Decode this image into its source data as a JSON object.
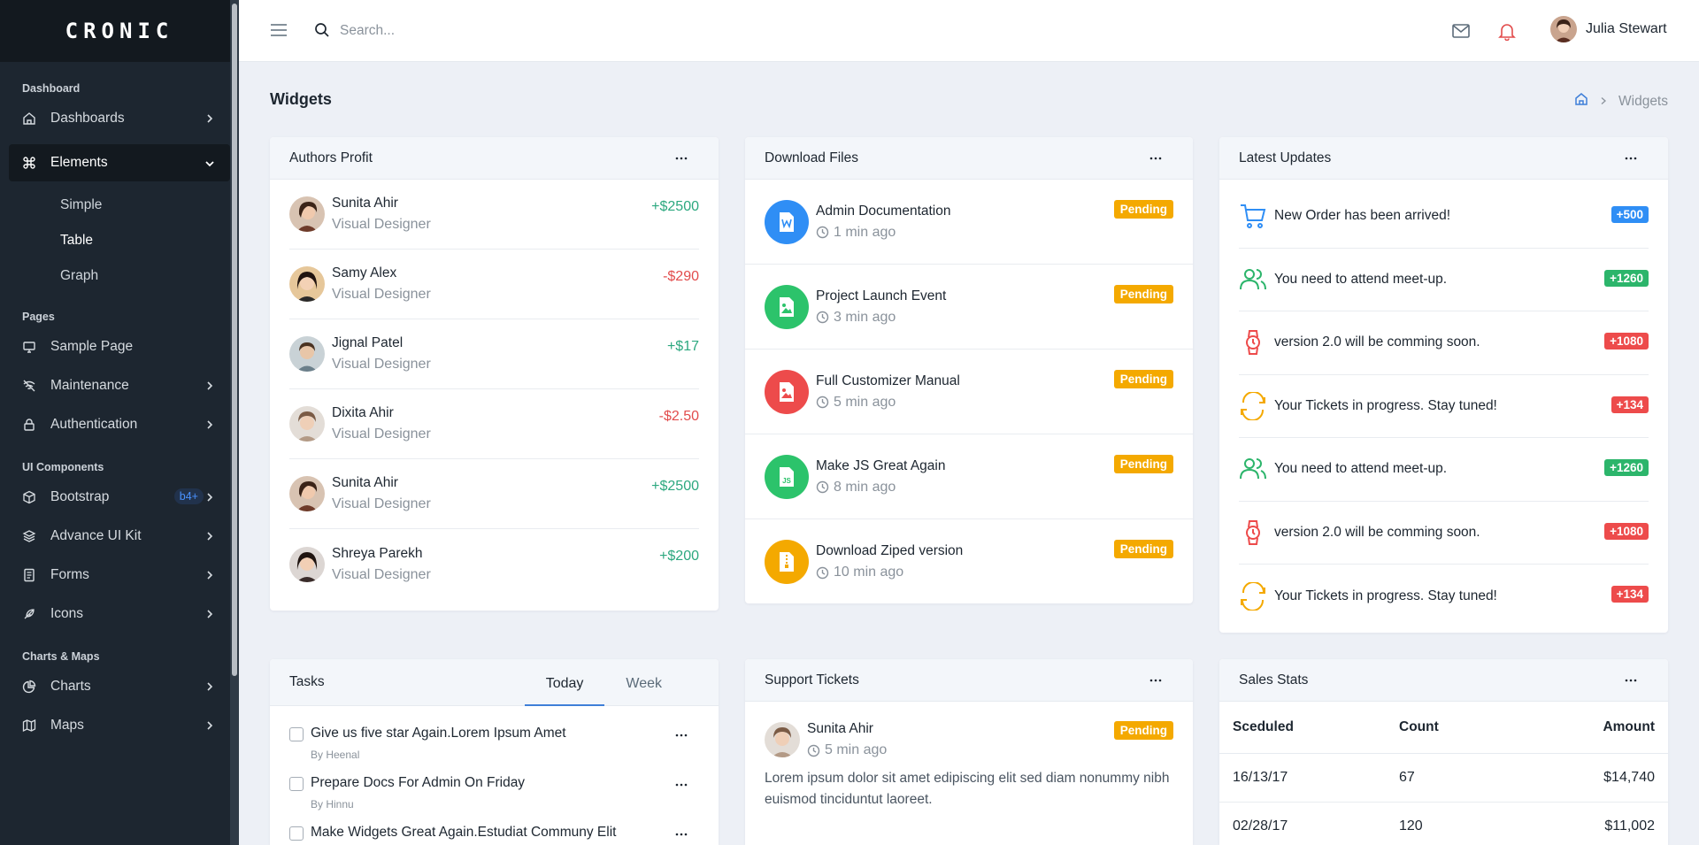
{
  "brand": {
    "logo": "CRONIC"
  },
  "sidebar": {
    "groups": [
      {
        "caption": "Dashboard"
      },
      {
        "caption": "Pages"
      },
      {
        "caption": "UI Components"
      },
      {
        "caption": "Charts & Maps"
      }
    ],
    "items": {
      "dashboards": "Dashboards",
      "elements": "Elements",
      "simple": "Simple",
      "table": "Table",
      "graph": "Graph",
      "sample_page": "Sample Page",
      "maintenance": "Maintenance",
      "authentication": "Authentication",
      "bootstrap": "Bootstrap",
      "bootstrap_badge": "b4+",
      "advance_ui_kit": "Advance UI Kit",
      "forms": "Forms",
      "icons": "Icons",
      "charts": "Charts",
      "maps": "Maps"
    }
  },
  "header": {
    "search_placeholder": "Search...",
    "user_name": "Julia Stewart"
  },
  "page": {
    "title": "Widgets",
    "breadcrumb_current": "Widgets"
  },
  "authors_profit": {
    "title": "Authors Profit",
    "rows": [
      {
        "name": "Sunita Ahir",
        "role": "Visual Designer",
        "amount": "+$2500"
      },
      {
        "name": "Samy Alex",
        "role": "Visual Designer",
        "amount": "-$290"
      },
      {
        "name": "Jignal Patel",
        "role": "Visual Designer",
        "amount": "+$17"
      },
      {
        "name": "Dixita Ahir",
        "role": "Visual Designer",
        "amount": "-$2.50"
      },
      {
        "name": "Sunita Ahir",
        "role": "Visual Designer",
        "amount": "+$2500"
      },
      {
        "name": "Shreya Parekh",
        "role": "Visual Designer",
        "amount": "+$200"
      }
    ]
  },
  "download_files": {
    "title": "Download Files",
    "rows": [
      {
        "name": "Admin Documentation",
        "time": "1 min ago",
        "status": "Pending",
        "icon": "word-file-icon",
        "color": "#2f8ef5"
      },
      {
        "name": "Project Launch Event",
        "time": "3 min ago",
        "status": "Pending",
        "icon": "image-file-icon",
        "color": "#2cc36b"
      },
      {
        "name": "Full Customizer Manual",
        "time": "5 min ago",
        "status": "Pending",
        "icon": "image-file-icon",
        "color": "#ed4b4b"
      },
      {
        "name": "Make JS Great Again",
        "time": "8 min ago",
        "status": "Pending",
        "icon": "js-file-icon",
        "color": "#2cc36b"
      },
      {
        "name": "Download Ziped version",
        "time": "10 min ago",
        "status": "Pending",
        "icon": "zip-file-icon",
        "color": "#f4a900"
      }
    ]
  },
  "latest_updates": {
    "title": "Latest Updates",
    "rows": [
      {
        "text": "New Order has been arrived!",
        "badge": "+500",
        "icon": "cart-icon",
        "color": "#2f8ef5"
      },
      {
        "text": "You need to attend meet-up.",
        "badge": "+1260",
        "icon": "users-icon",
        "color": "#2cb56b"
      },
      {
        "text": "version 2.0 will be comming soon.",
        "badge": "+1080",
        "icon": "watch-icon",
        "color": "#ed4b4b"
      },
      {
        "text": "Your Tickets in progress. Stay tuned!",
        "badge": "+134",
        "icon": "refresh-icon",
        "color": "#ed4b4b",
        "icon_color": "#f4a900"
      },
      {
        "text": "You need to attend meet-up.",
        "badge": "+1260",
        "icon": "users-icon",
        "color": "#2cb56b"
      },
      {
        "text": "version 2.0 will be comming soon.",
        "badge": "+1080",
        "icon": "watch-icon",
        "color": "#ed4b4b"
      },
      {
        "text": "Your Tickets in progress. Stay tuned!",
        "badge": "+134",
        "icon": "refresh-icon",
        "color": "#ed4b4b",
        "icon_color": "#f4a900"
      }
    ]
  },
  "tasks": {
    "title": "Tasks",
    "tabs": [
      "Today",
      "Week"
    ],
    "rows": [
      {
        "text": "Give us five star Again.Lorem Ipsum Amet",
        "by": "By Heenal"
      },
      {
        "text": "Prepare Docs For Admin On Friday",
        "by": "By Hinnu"
      },
      {
        "text": "Make Widgets Great Again.Estudiat Communy Elit",
        "by": ""
      }
    ]
  },
  "support_tickets": {
    "title": "Support Tickets",
    "ticket": {
      "name": "Sunita Ahir",
      "time": "5 min ago",
      "status": "Pending",
      "body": "Lorem ipsum dolor sit amet edipiscing elit sed diam nonummy nibh euismod tinciduntut laoreet."
    }
  },
  "sales_stats": {
    "title": "Sales Stats",
    "columns": [
      "Sceduled",
      "Count",
      "Amount"
    ],
    "rows": [
      [
        "16/13/17",
        "67",
        "$14,740"
      ],
      [
        "02/28/17",
        "120",
        "$11,002"
      ]
    ]
  },
  "colors": {
    "sidebar_bg": "#1d2630",
    "sidebar_active_bg": "#13191f",
    "positive": "#2ca87f",
    "negative": "#e24c4c",
    "pending": "#f4a900",
    "accent": "#3f7fd8"
  }
}
